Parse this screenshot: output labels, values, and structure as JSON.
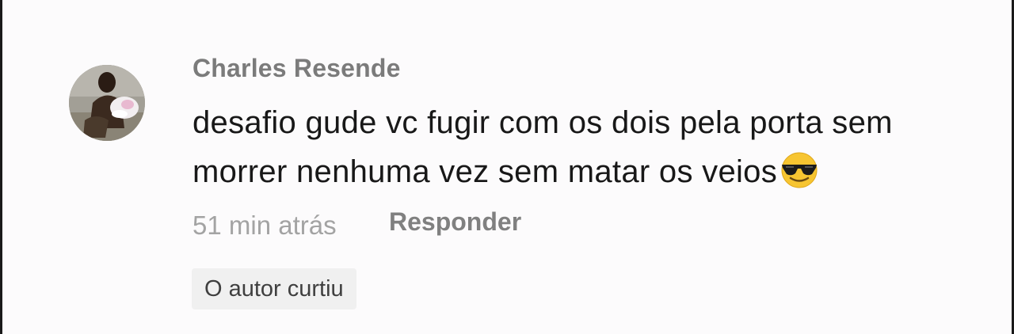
{
  "comment": {
    "author": "Charles Resende",
    "text": "desafio gude vc fugir com os dois pela porta sem morrer nenhuma vez sem matar os veios",
    "emoji_icon": "smiling-face-with-sunglasses-icon",
    "timestamp": "51 min atrás",
    "reply_label": "Responder",
    "liked_badge": "O autor curtiu"
  }
}
